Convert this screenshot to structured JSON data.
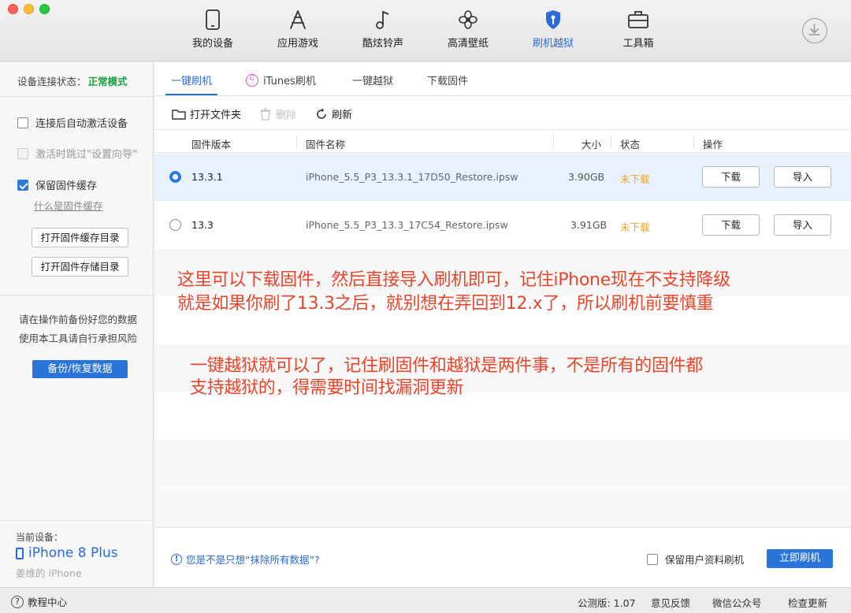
{
  "nav": {
    "items": [
      {
        "label": "我的设备",
        "icon": "phone-icon"
      },
      {
        "label": "应用游戏",
        "icon": "app-store-icon"
      },
      {
        "label": "酷炫铃声",
        "icon": "music-note-icon"
      },
      {
        "label": "高清壁纸",
        "icon": "flower-icon"
      },
      {
        "label": "刷机越狱",
        "icon": "shield-key-icon"
      },
      {
        "label": "工具箱",
        "icon": "toolbox-icon"
      }
    ],
    "active_index": 4,
    "accent": "#2a6ad9"
  },
  "sidebar": {
    "conn_label": "设备连接状态：",
    "conn_status": "正常模式",
    "opt_auto_activate": "连接后自动激活设备",
    "opt_skip_setup": "激活时跳过\"设置向导\"",
    "opt_keep_cache": "保留固件缓存",
    "what_is_cache": "什么是固件缓存",
    "open_cache_dir": "打开固件缓存目录",
    "open_storage_dir": "打开固件存储目录",
    "warn_line1": "请在操作前备份好您的数据",
    "warn_line2": "使用本工具请自行承担风险",
    "backup_button": "备份/恢复数据",
    "device_label": "当前设备：",
    "device_name": "iPhone 8 Plus",
    "device_owner": "姜维的 iPhone"
  },
  "tabs": [
    "一键刷机",
    "iTunes刷机",
    "一键越狱",
    "下载固件"
  ],
  "toolbar": {
    "open_folder": "打开文件夹",
    "delete": "删除",
    "refresh": "刷新"
  },
  "table": {
    "headers": {
      "version": "固件版本",
      "name": "固件名称",
      "size": "大小",
      "status": "状态",
      "action": "操作"
    },
    "rows": [
      {
        "version": "13.3.1",
        "name": "iPhone_5.5_P3_13.3.1_17D50_Restore.ipsw",
        "size": "3.90GB",
        "status": "未下载",
        "download": "下载",
        "import": "导入"
      },
      {
        "version": "13.3",
        "name": "iPhone_5.5_P3_13.3_17C54_Restore.ipsw",
        "size": "3.91GB",
        "status": "未下载",
        "download": "下载",
        "import": "导入"
      }
    ]
  },
  "annotations": {
    "note1_line1": "这里可以下载固件，然后直接导入刷机即可，记住iPhone现在不支持降级",
    "note1_line2": "就是如果你刷了13.3之后，就别想在弄回到12.x了，所以刷机前要慎重",
    "note2_line1": "一键越狱就可以了，记住刷固件和越狱是两件事，不是所有的固件都",
    "note2_line2": "支持越狱的，得需要时间找漏洞更新",
    "color": "#e8452a"
  },
  "bottom": {
    "erase_question": "您是不是只想“抹除所有数据”?",
    "keep_user_data": "保留用户资料刷机",
    "flash_now": "立即刷机"
  },
  "statusbar": {
    "help": "教程中心",
    "version": "公测版: 1.07",
    "feedback": "意见反馈",
    "wechat": "微信公众号",
    "check_update": "检查更新"
  }
}
